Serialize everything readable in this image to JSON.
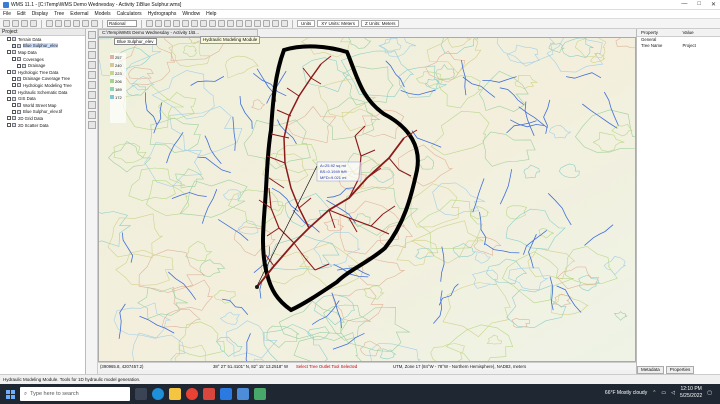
{
  "window": {
    "title": "WMS 11.1 - [C:\\Temp\\WMS Demo Wednesday - Activity 1\\Blue Sulphur.wms]",
    "controls": [
      "—",
      "□",
      "✕"
    ]
  },
  "menu": [
    "File",
    "Edit",
    "Display",
    "Tree",
    "External",
    "Models",
    "Calculators",
    "Hydrographs",
    "Window",
    "Help"
  ],
  "toolbar": {
    "model_select": "Rational",
    "units_label": "Units",
    "xy_units": "XY Units: Meters",
    "z_units": "Z Units: Meters"
  },
  "project_tree": {
    "header": "Project",
    "items": [
      {
        "label": "Terrain Data",
        "indent": 1
      },
      {
        "label": "Blue Sulphur_elev",
        "indent": 2,
        "selected": true
      },
      {
        "label": "Map Data",
        "indent": 1
      },
      {
        "label": "Coverages",
        "indent": 2
      },
      {
        "label": "Drainage",
        "indent": 3
      },
      {
        "label": "Hydrologic Tree Data",
        "indent": 1
      },
      {
        "label": "Drainage Coverage Tree",
        "indent": 2
      },
      {
        "label": "Hydrologic Modeling Tree",
        "indent": 2
      },
      {
        "label": "Hydraulic Schematic Data",
        "indent": 1
      },
      {
        "label": "GIS Data",
        "indent": 1
      },
      {
        "label": "World Street Map",
        "indent": 2
      },
      {
        "label": "Blue Sulphur_elev.tif",
        "indent": 2
      },
      {
        "label": "2D Grid Data",
        "indent": 1
      },
      {
        "label": "2D Scatter Data",
        "indent": 1
      }
    ]
  },
  "document_tab": "C:\\Temp\\WMS Demo Wednesday - Activity 1\\B...",
  "view_subtab": "Blue Sulphur_elev",
  "tooltip": "Hydraulic Modeling Module",
  "elevation_legend": [
    "257",
    "240",
    "223",
    "206",
    "189",
    "172"
  ],
  "legend_colors": [
    "#e0b0a0",
    "#d6c89a",
    "#c9d58a",
    "#a9d28c",
    "#8ed2b0",
    "#7fc7d6"
  ],
  "basin_label": [
    "A=25.92 sq mi",
    "BS=0.1949 ft/ft",
    "MFD=9.021 mi"
  ],
  "coordinates": {
    "xy": "(390965.8, 4207457.2)",
    "latlon": "38° 27' 51.4101\" N, 82° 15' 13.2518\" W",
    "tool_hint": "Select Tree Outlet Tool Selected",
    "projection": "UTM, Zone 17 (84°W - 78°W - Northern Hemisphere), NAD83, meters"
  },
  "properties": {
    "col_property": "Property",
    "col_value": "Value",
    "group": "General",
    "rows": [
      {
        "property": "Tree Name",
        "value": "Project"
      }
    ],
    "tabs": [
      "Metadata",
      "Properties"
    ]
  },
  "status": "Hydraulic Modeling Module.  Tools for 1D hydraulic model generation.",
  "taskbar": {
    "search_placeholder": "Type here to search",
    "weather": "66°F  Mostly cloudy",
    "time": "12:10 PM",
    "date": "5/25/2022"
  }
}
